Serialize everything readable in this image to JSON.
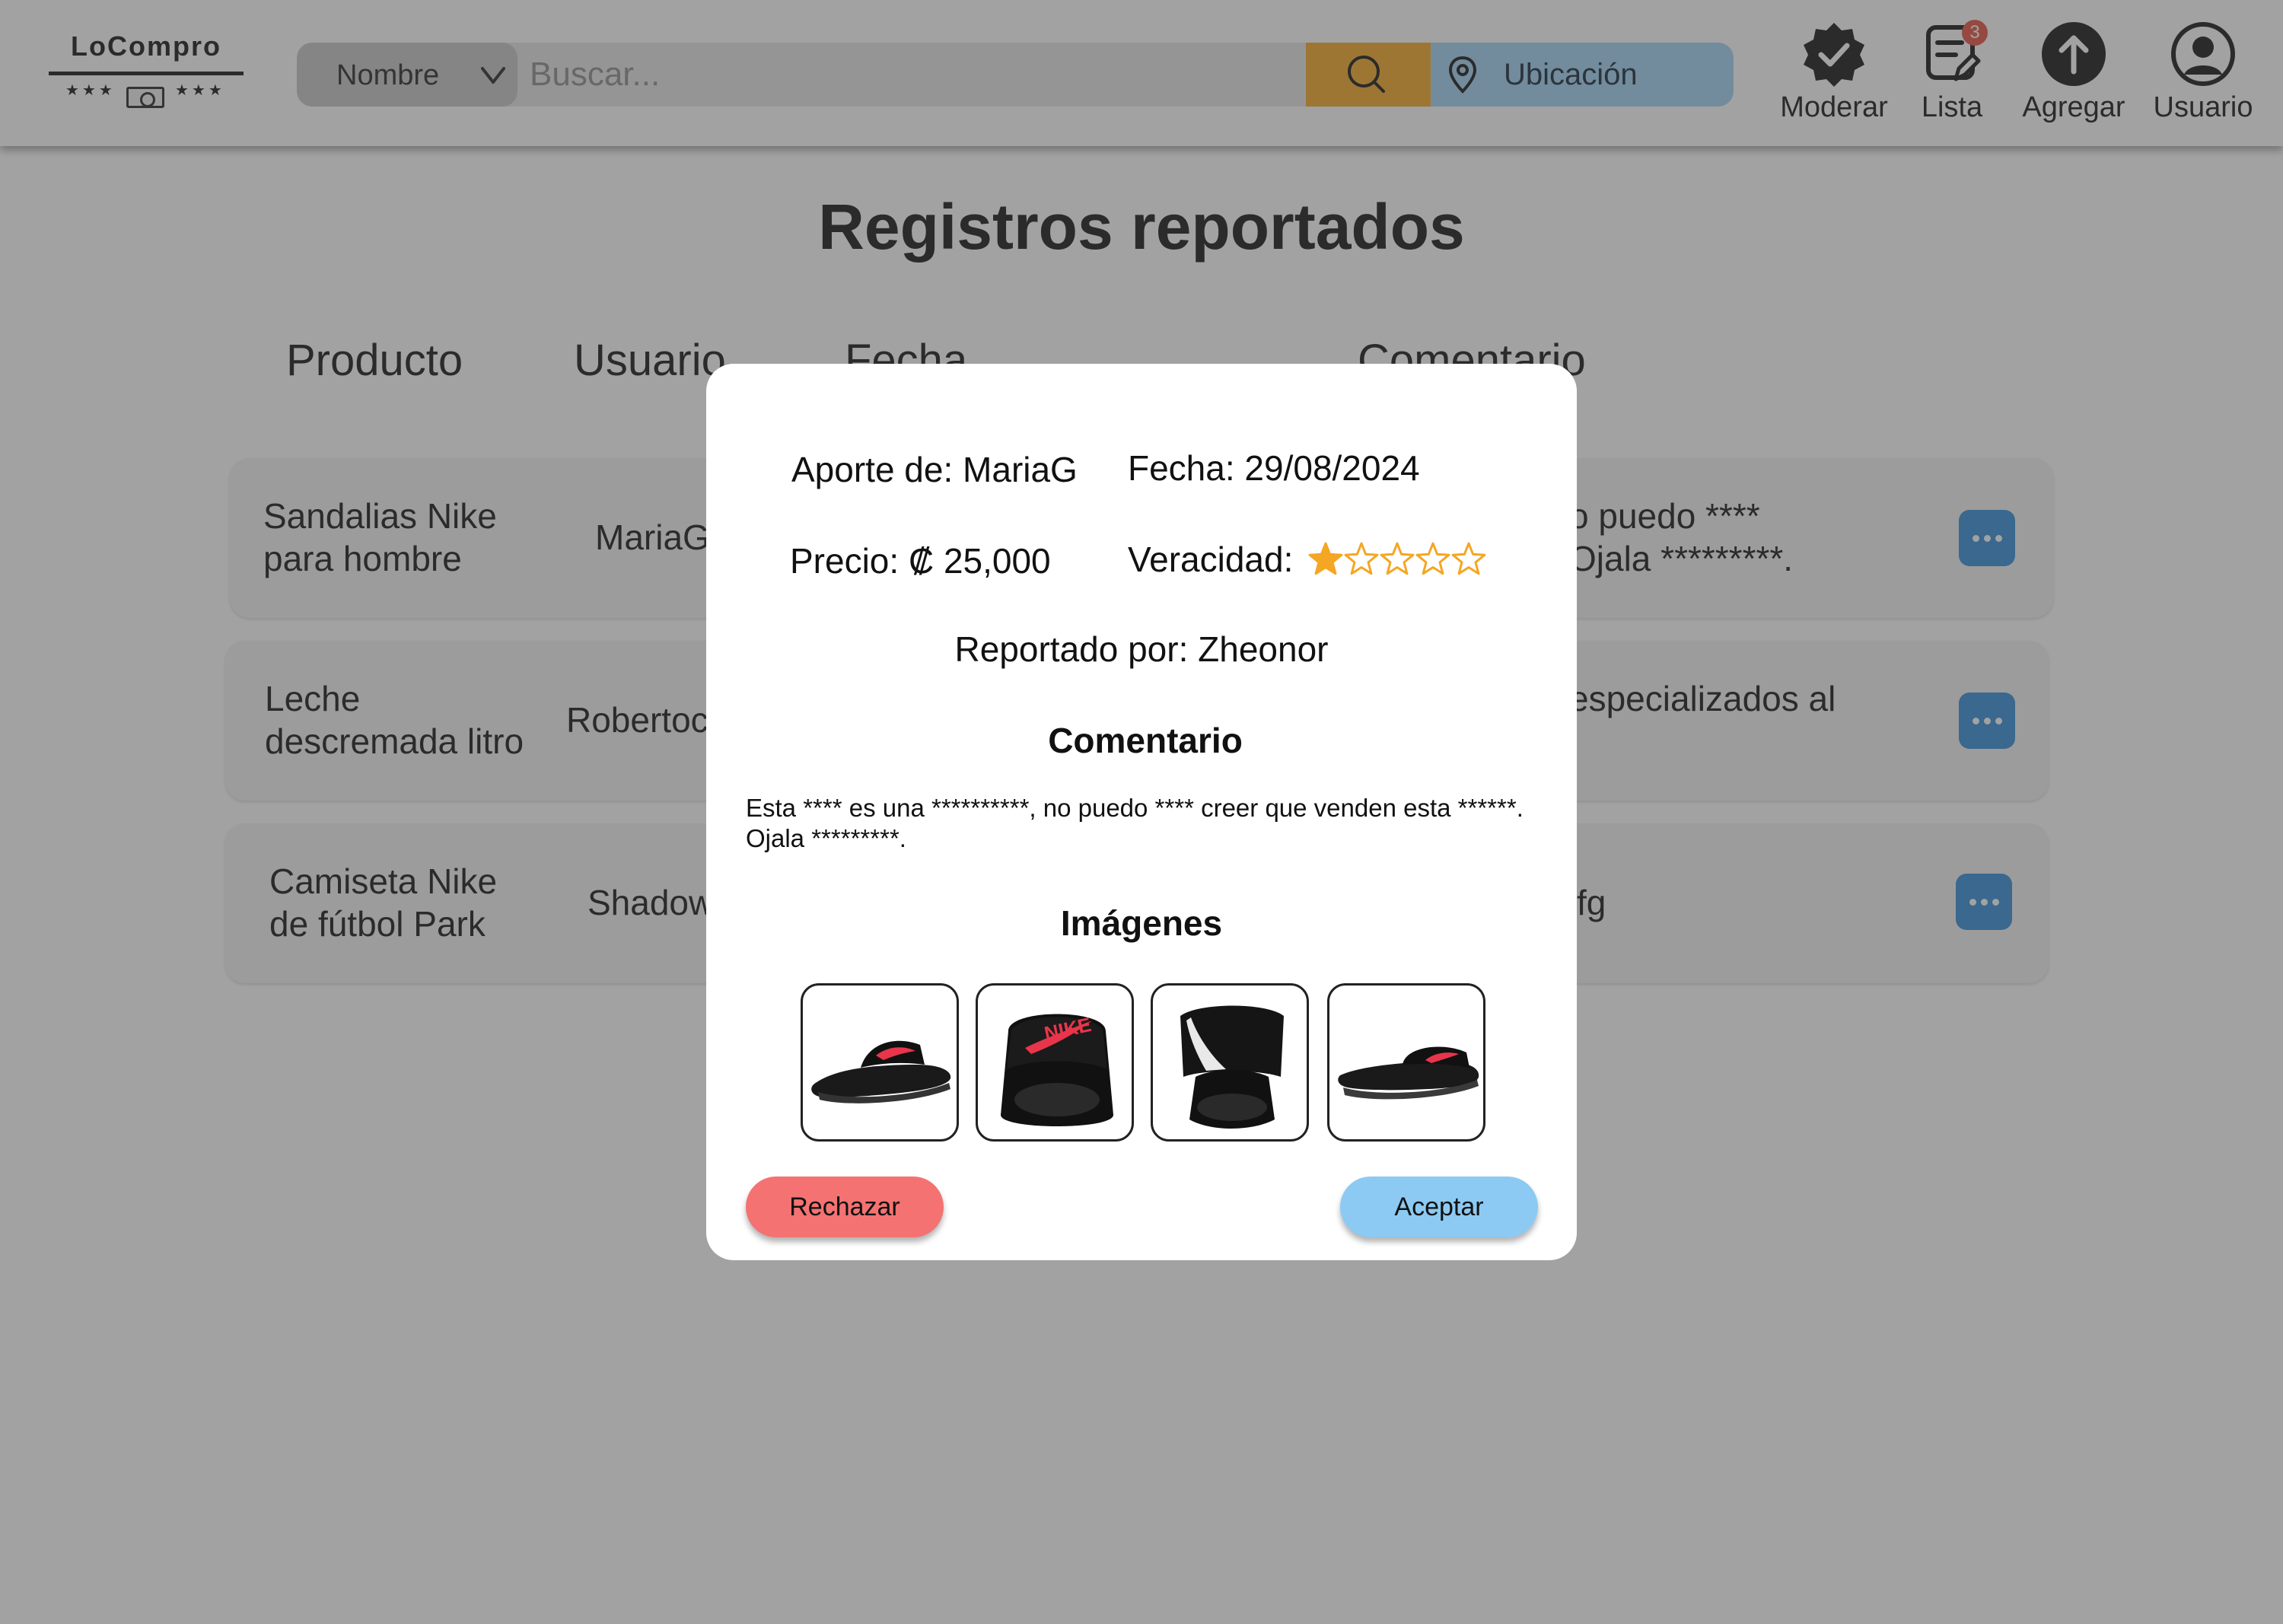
{
  "header": {
    "logo_text": "LoCompro",
    "logo_stars": "★★★",
    "search": {
      "filter_selected": "Nombre",
      "placeholder": "Buscar...",
      "location_label": "Ubicación"
    },
    "nav": {
      "moderate": "Moderar",
      "list": "Lista",
      "list_badge": "3",
      "add": "Agregar",
      "user": "Usuario"
    }
  },
  "page": {
    "title": "Registros reportados",
    "columns": [
      "Producto",
      "Usuario",
      "Fecha",
      "Comentario"
    ],
    "rows": [
      {
        "product_line1": "Sandalias Nike",
        "product_line2": "para hombre",
        "user": "MariaG",
        "comment_line1": "o puedo ****",
        "comment_line2": "Ojala *********."
      },
      {
        "product_line1": "Leche",
        "product_line2": "descremada litro",
        "user": "Robertoc",
        "comment_line1": "especializados al",
        "comment_line2": ""
      },
      {
        "product_line1": "Camiseta Nike",
        "product_line2": "de fútbol Park",
        "user": "Shadow",
        "comment_line1": "fg",
        "comment_line2": ""
      }
    ]
  },
  "modal": {
    "contribution": "Aporte de: MariaG",
    "date": "Fecha: 29/08/2024",
    "price": "Precio: ₡ 25,000",
    "veracity_label": "Veracidad:",
    "veracity_rating": 1,
    "veracity_max": 5,
    "reported_by": "Reportado por: Zheonor",
    "comment_heading": "Comentario",
    "comment_text": "Esta **** es una **********, no puedo **** creer que venden esta ******. Ojala *********.",
    "images_heading": "Imágenes",
    "images": [
      "sandal-side",
      "sandal-front",
      "sandal-back",
      "sandal-profile"
    ],
    "reject_label": "Rechazar",
    "accept_label": "Aceptar"
  },
  "colors": {
    "search_button": "#f5a623",
    "location_button": "#9fd3f5",
    "more_button": "#2e8bd6",
    "reject": "#f47272",
    "accept": "#8ccaf3",
    "star": "#f5a623",
    "badge": "#e74c3c"
  }
}
